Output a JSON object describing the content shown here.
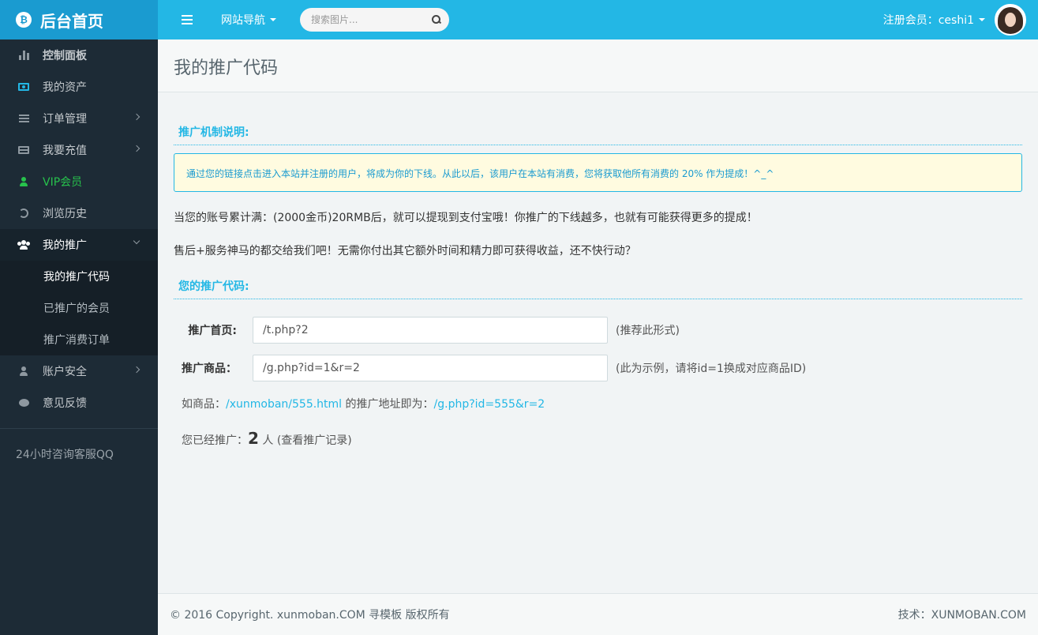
{
  "brand": {
    "icon": "bitcoin-icon",
    "title": "后台首页",
    "accent": "#23b7e5"
  },
  "topnav": {
    "menu_icon": "menu-icon",
    "site_nav_label": "网站导航",
    "search_placeholder": "搜索图片...",
    "user_label": "注册会员：ceshi1"
  },
  "sidebar": {
    "items": [
      {
        "label": "控制面板",
        "icon": "bar-chart-icon"
      },
      {
        "label": "我的资产",
        "icon": "money-icon"
      },
      {
        "label": "订单管理",
        "icon": "list-icon"
      },
      {
        "label": "我要充值",
        "icon": "credit-card-icon"
      },
      {
        "label": "VIP会员",
        "icon": "user-icon"
      },
      {
        "label": "浏览历史",
        "icon": "history-icon"
      },
      {
        "label": "我的推广",
        "icon": "users-icon"
      },
      {
        "label": "账户安全",
        "icon": "user-icon"
      },
      {
        "label": "意见反馈",
        "icon": "chat-icon"
      }
    ],
    "sub_items": [
      "我的推广代码",
      "已推广的会员",
      "推广消费订单"
    ],
    "qq_text": "24小时咨询客服QQ"
  },
  "page": {
    "title": "我的推广代码",
    "section1_title": "推广机制说明:",
    "notice": "通过您的链接点击进入本站并注册的用户，将成为你的下线。从此以后，该用户在本站有消费，您将获取他所有消费的 20% 作为提成！^_^",
    "para1": "当您的账号累计满：(2000金币)20RMB后，就可以提现到支付宝哦！你推广的下线越多，也就有可能获得更多的提成！",
    "para2": "售后+服务神马的都交给我们吧！无需你付出其它额外时间和精力即可获得收益，还不快行动？",
    "section2_title": "您的推广代码:",
    "home_label": "推广首页:",
    "home_value": "/t.php?2",
    "home_hint": "(推荐此形式)",
    "product_label": "推广商品：",
    "product_value": "/g.php?id=1&r=2",
    "product_hint": "(此为示例，请将id=1换成对应商品ID)",
    "example_prefix": "如商品：",
    "example_link1": "/xunmoban/555.html",
    "example_mid": " 的推广地址即为：",
    "example_link2": "/g.php?id=555&r=2",
    "count_prefix": "您已经推广：",
    "count_value": "2",
    "count_suffix": " 人 (查看推广记录)"
  },
  "footer": {
    "copyright": "© 2016 Copyright. xunmoban.COM 寻模板 版权所有",
    "tech": "技术：XUNMOBAN.COM"
  }
}
